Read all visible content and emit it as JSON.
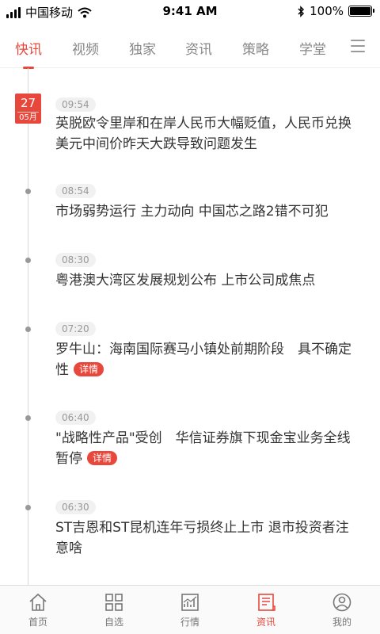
{
  "status_bar": {
    "carrier": "中国移动",
    "time": "9:41 AM",
    "battery": "100%"
  },
  "tabs": [
    {
      "label": "快讯",
      "active": true
    },
    {
      "label": "视频",
      "active": false
    },
    {
      "label": "独家",
      "active": false
    },
    {
      "label": "资讯",
      "active": false
    },
    {
      "label": "策略",
      "active": false
    },
    {
      "label": "学堂",
      "active": false
    }
  ],
  "date_badge": {
    "day": "27",
    "month": "05月"
  },
  "news": [
    {
      "time": "09:54",
      "text": "英脱欧令里岸和在岸人民币大幅贬值，人民币兑换美元中间价昨天大跌导致问题发生"
    },
    {
      "time": "08:54",
      "text": "市场弱势运行 主力动向 中国芯之路2错不可犯"
    },
    {
      "time": "08:30",
      "text": "粤港澳大湾区发展规划公布 上市公司成焦点"
    },
    {
      "time": "07:20",
      "text": "罗牛山：海南国际赛马小镇处前期阶段　具不确定性",
      "tag": "详情"
    },
    {
      "time": "06:40",
      "text": "\"战略性产品\"受创　华信证券旗下现金宝业务全线暂停",
      "tag": "详情"
    },
    {
      "time": "06:30",
      "text": "ST吉恩和ST昆机连年亏损终止上市 退市投资者注意啥"
    }
  ],
  "bottom_nav": [
    {
      "label": "首页",
      "icon": "home-icon",
      "active": false
    },
    {
      "label": "自选",
      "icon": "grid-icon",
      "active": false
    },
    {
      "label": "行情",
      "icon": "chart-icon",
      "active": false
    },
    {
      "label": "资讯",
      "icon": "news-icon",
      "active": true
    },
    {
      "label": "我的",
      "icon": "user-icon",
      "active": false
    }
  ],
  "colors": {
    "accent": "#e8483c",
    "muted": "#999999",
    "text": "#333333"
  }
}
